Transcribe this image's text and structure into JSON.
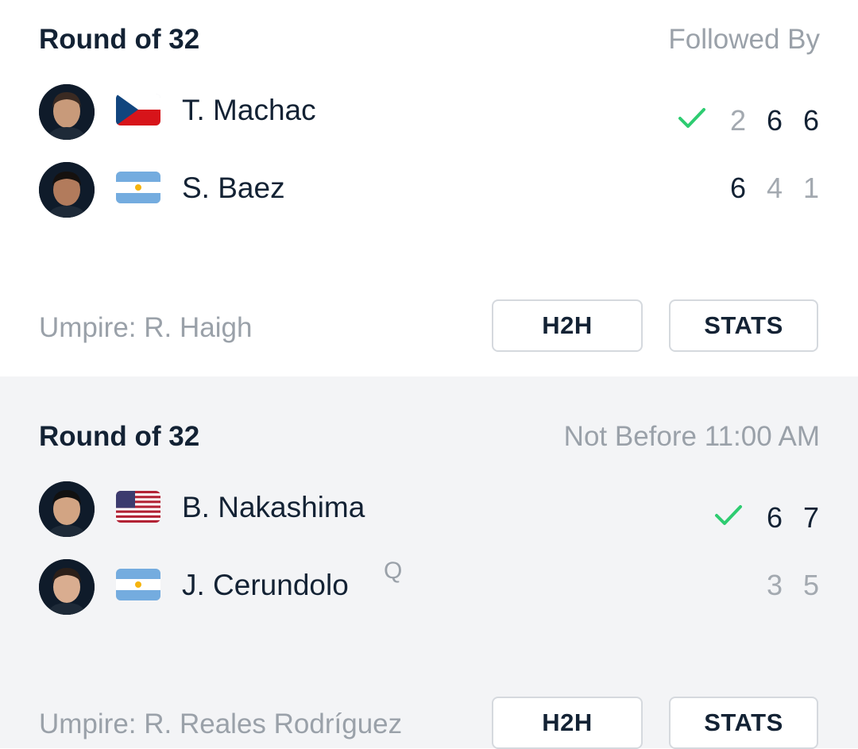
{
  "matches": [
    {
      "round": "Round of 32",
      "meta": "Followed By",
      "players": [
        {
          "name": "T. Machac",
          "seed": "",
          "flag": "czech-republic",
          "winner": true,
          "scores": [
            "2",
            "6",
            "6"
          ],
          "score_wins": [
            false,
            true,
            true
          ]
        },
        {
          "name": "S. Baez",
          "seed": "",
          "flag": "argentina",
          "winner": false,
          "scores": [
            "6",
            "4",
            "1"
          ],
          "score_wins": [
            true,
            false,
            false
          ]
        }
      ],
      "umpire": "Umpire: R. Haigh",
      "h2h_label": "H2H",
      "stats_label": "STATS"
    },
    {
      "round": "Round of 32",
      "meta": "Not Before 11:00 AM",
      "players": [
        {
          "name": "B. Nakashima",
          "seed": "",
          "flag": "united-states",
          "winner": true,
          "scores": [
            "6",
            "7"
          ],
          "score_wins": [
            true,
            true
          ]
        },
        {
          "name": "J. Cerundolo",
          "seed": "Q",
          "flag": "argentina",
          "winner": false,
          "scores": [
            "3",
            "5"
          ],
          "score_wins": [
            false,
            false
          ]
        }
      ],
      "umpire": "Umpire: R. Reales Rodríguez",
      "h2h_label": "H2H",
      "stats_label": "STATS"
    }
  ],
  "colors": {
    "check": "#2ecc71",
    "text_primary": "#132234",
    "text_muted": "#9aa1a9",
    "card_alt_bg": "#f3f4f6"
  },
  "icons": {
    "winner": "check-icon"
  }
}
